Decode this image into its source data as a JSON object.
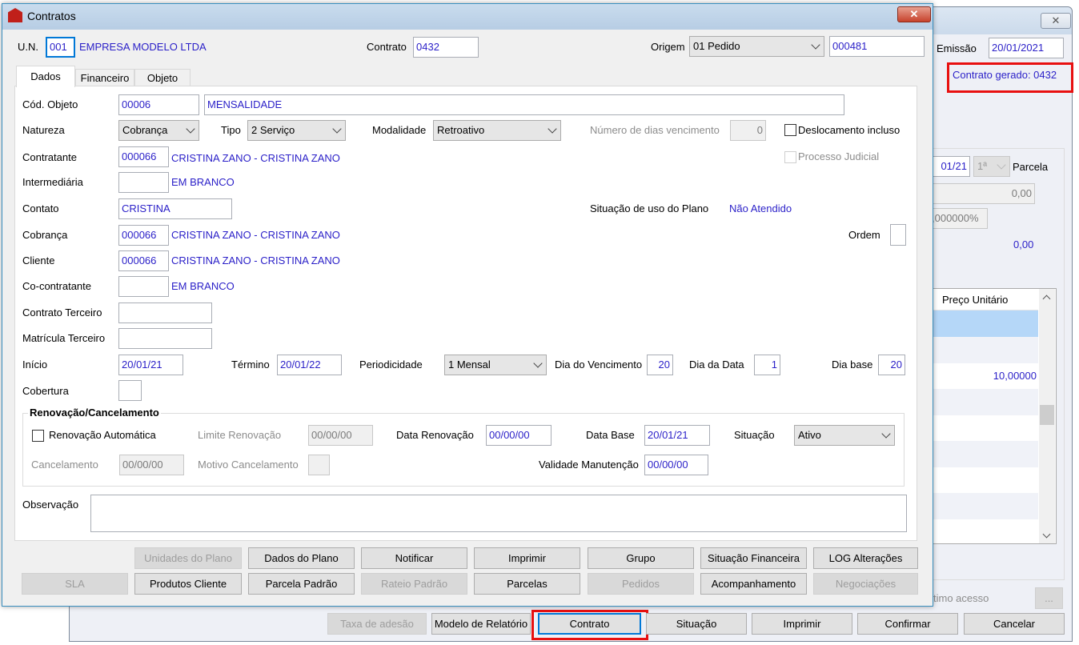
{
  "back": {
    "emissao_label": "Emissão",
    "emissao_value": "20/01/2021",
    "contrato_gerado": "Contrato gerado: 0432",
    "parcela_date": "01/21",
    "parcela_select": "1ª",
    "parcela_label": "Parcela",
    "valor1": "0,00",
    "percent": ",000000%",
    "total": "0,00",
    "grid_header": "Preço Unitário",
    "grid_value": "10,00000",
    "ultimo_acesso": "timo acesso",
    "dots": "...",
    "buttons": [
      "Taxa de adesão",
      "Modelo de Relatório",
      "Contrato",
      "Situação",
      "Imprimir",
      "Confirmar",
      "Cancelar"
    ]
  },
  "front": {
    "title": "Contratos",
    "un_label": "U.N.",
    "un_value": "001",
    "un_name": "EMPRESA MODELO LTDA",
    "contrato_label": "Contrato",
    "contrato_value": "0432",
    "origem_label": "Origem",
    "origem_value": "01 Pedido",
    "origem_code": "000481",
    "tabs": [
      "Dados",
      "Financeiro",
      "Objeto"
    ],
    "cod_objeto_label": "Cód. Objeto",
    "cod_objeto_value": "00006",
    "cod_objeto_desc": "MENSALIDADE",
    "natureza_label": "Natureza",
    "natureza_value": "Cobrança",
    "tipo_label": "Tipo",
    "tipo_value": "2 Serviço",
    "modalidade_label": "Modalidade",
    "modalidade_value": "Retroativo",
    "num_dias_label": "Número de dias vencimento",
    "num_dias_value": "0",
    "deslocamento_label": "Deslocamento incluso",
    "contratante_label": "Contratante",
    "contratante_code": "000066",
    "contratante_name": "CRISTINA ZANO - CRISTINA ZANO",
    "processo_label": "Processo Judicial",
    "intermediaria_label": "Intermediária",
    "intermediaria_name": "EM BRANCO",
    "contato_label": "Contato",
    "contato_value": "CRISTINA",
    "situacao_uso_label": "Situação de uso do Plano",
    "situacao_uso_value": "Não Atendido",
    "cobranca_label": "Cobrança",
    "cobranca_code": "000066",
    "cobranca_name": "CRISTINA ZANO - CRISTINA ZANO",
    "ordem_label": "Ordem",
    "cliente_label": "Cliente",
    "cliente_code": "000066",
    "cliente_name": "CRISTINA ZANO - CRISTINA ZANO",
    "cocontratante_label": "Co-contratante",
    "cocontratante_name": "EM BRANCO",
    "contrato_terceiro_label": "Contrato Terceiro",
    "matricula_terceiro_label": "Matrícula Terceiro",
    "inicio_label": "Início",
    "inicio_value": "20/01/21",
    "termino_label": "Término",
    "termino_value": "20/01/22",
    "periodicidade_label": "Periodicidade",
    "periodicidade_value": "1 Mensal",
    "dia_venc_label": "Dia do Vencimento",
    "dia_venc_value": "20",
    "dia_data_label": "Dia da Data",
    "dia_data_value": "1",
    "dia_base_label": "Dia base",
    "dia_base_value": "20",
    "cobertura_label": "Cobertura",
    "renov": {
      "title": "Renovação/Cancelamento",
      "auto_label": "Renovação Automática",
      "limite_label": "Limite Renovação",
      "limite_value": "00/00/00",
      "data_renov_label": "Data Renovação",
      "data_renov_value": "00/00/00",
      "data_base_label": "Data Base",
      "data_base_value": "20/01/21",
      "situacao_label": "Situação",
      "situacao_value": "Ativo",
      "cancel_label": "Cancelamento",
      "cancel_value": "00/00/00",
      "motivo_label": "Motivo Cancelamento",
      "validade_label": "Validade Manutenção",
      "validade_value": "00/00/00"
    },
    "observacao_label": "Observação",
    "buttons_row1": [
      "Unidades do Plano",
      "Dados do Plano",
      "Notificar",
      "Imprimir",
      "Grupo",
      "Situação Financeira",
      "LOG Alterações"
    ],
    "buttons_row2": [
      "SLA",
      "Produtos Cliente",
      "Parcela Padrão",
      "Rateio Padrão",
      "Parcelas",
      "Pedidos",
      "Acompanhamento",
      "Negociações"
    ]
  },
  "colors": {
    "highlight": "#e81010",
    "value_text": "#2a1fc8"
  }
}
